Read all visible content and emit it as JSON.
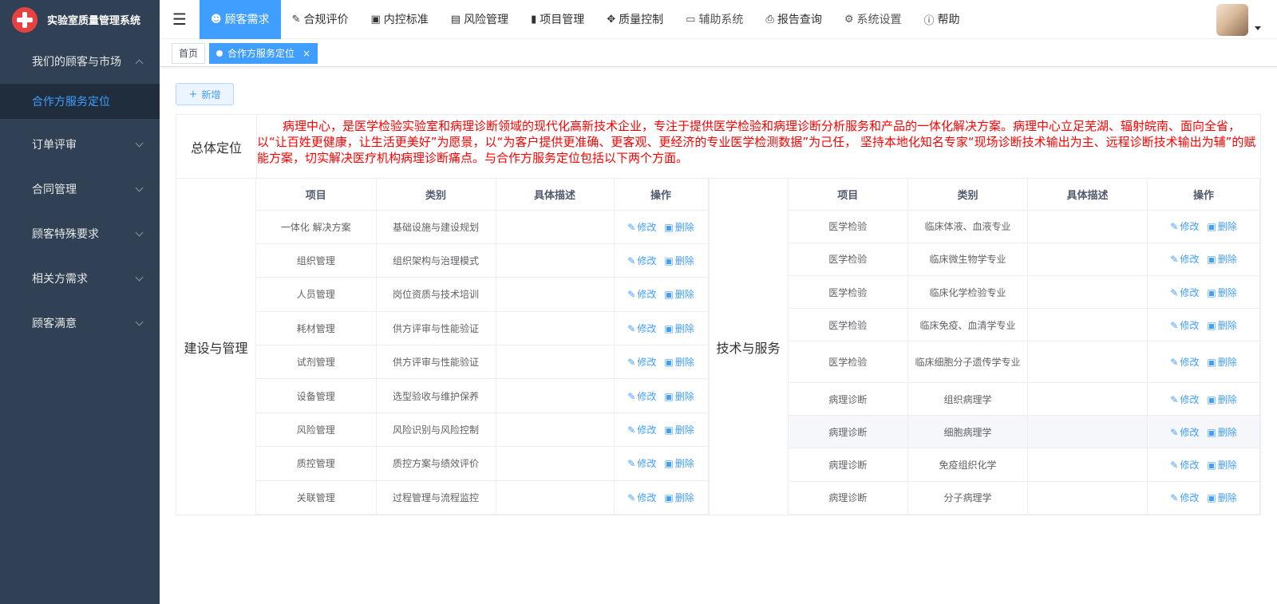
{
  "app": {
    "title": "实验室质量管理系统"
  },
  "sidebar": {
    "items": [
      {
        "label": "我们的顾客与市场",
        "expanded": true,
        "children": [
          {
            "label": "合作方服务定位",
            "active": true
          }
        ]
      },
      {
        "label": "订单评审"
      },
      {
        "label": "合同管理"
      },
      {
        "label": "顾客特殊要求"
      },
      {
        "label": "相关方需求"
      },
      {
        "label": "顾客满意"
      }
    ]
  },
  "topnav": {
    "items": [
      {
        "label": "顾客需求",
        "icon": "user-icon",
        "active": true
      },
      {
        "label": "合规评价",
        "icon": "edit-icon"
      },
      {
        "label": "内控标准",
        "icon": "picture-icon"
      },
      {
        "label": "风险管理",
        "icon": "monitor-chart-icon"
      },
      {
        "label": "项目管理",
        "icon": "bar-chart-icon"
      },
      {
        "label": "质量控制",
        "icon": "move-icon"
      },
      {
        "label": "辅助系统",
        "icon": "monitor-icon"
      },
      {
        "label": "报告查询",
        "icon": "printer-icon"
      },
      {
        "label": "系统设置",
        "icon": "gear-icon"
      },
      {
        "label": "帮助",
        "icon": "question-icon"
      }
    ]
  },
  "tags": {
    "home": "首页",
    "current": "合作方服务定位",
    "close": "×"
  },
  "toolbar": {
    "add_label": "新增",
    "add_icon": "+"
  },
  "overall": {
    "label": "总体定位",
    "text": "病理中心，是医学检验实验室和病理诊断领域的现代化高新技术企业，专注于提供医学检验和病理诊断分析服务和产品的一体化解决方案。病理中心立足芜湖、辐射皖南、面向全省，以“让百姓更健康，让生活更美好”为愿景，以“为客户提供更准确、更客观、更经济的专业医学检测数据”为己任， 坚持本地化知名专家“现场诊断技术输出为主、远程诊断技术输出为辅”的赋能方案，切实解决医疗机构病理诊断痛点。与合作方服务定位包括以下两个方面。"
  },
  "columns": {
    "item": "项目",
    "category": "类别",
    "desc": "具体描述",
    "op": "操作"
  },
  "ops": {
    "edit": "修改",
    "delete": "删除"
  },
  "left_section": {
    "label": "建设与管理",
    "rows": [
      {
        "item": "一体化 解决方案",
        "category": "基础设施与建设规划",
        "desc": ""
      },
      {
        "item": "组织管理",
        "category": "组织架构与治理模式",
        "desc": ""
      },
      {
        "item": "人员管理",
        "category": "岗位资质与技术培训",
        "desc": ""
      },
      {
        "item": "耗材管理",
        "category": "供方评审与性能验证",
        "desc": ""
      },
      {
        "item": "试剂管理",
        "category": "供方评审与性能验证",
        "desc": ""
      },
      {
        "item": "设备管理",
        "category": "选型验收与维护保养",
        "desc": ""
      },
      {
        "item": "风险管理",
        "category": "风险识别与风险控制",
        "desc": ""
      },
      {
        "item": "质控管理",
        "category": "质控方案与绩效评价",
        "desc": ""
      },
      {
        "item": "关联管理",
        "category": "过程管理与流程监控",
        "desc": ""
      }
    ]
  },
  "right_section": {
    "label": "技术与服务",
    "rows": [
      {
        "item": "医学检验",
        "category": "临床体液、血液专业",
        "desc": ""
      },
      {
        "item": "医学检验",
        "category": "临床微生物学专业",
        "desc": ""
      },
      {
        "item": "医学检验",
        "category": "临床化学检验专业",
        "desc": ""
      },
      {
        "item": "医学检验",
        "category": "临床免疫、血清学专业",
        "desc": ""
      },
      {
        "item": "医学检验",
        "category": "临床细胞分子遗传学专业",
        "desc": "",
        "tall": true
      },
      {
        "item": "病理诊断",
        "category": "组织病理学",
        "desc": ""
      },
      {
        "item": "病理诊断",
        "category": "细胞病理学",
        "desc": "",
        "highlight": true
      },
      {
        "item": "病理诊断",
        "category": "免疫组织化学",
        "desc": ""
      },
      {
        "item": "病理诊断",
        "category": "分子病理学",
        "desc": ""
      }
    ]
  },
  "colors": {
    "accent": "#409eff",
    "sidebar_bg": "#304156",
    "warning_text": "#ff0000"
  }
}
